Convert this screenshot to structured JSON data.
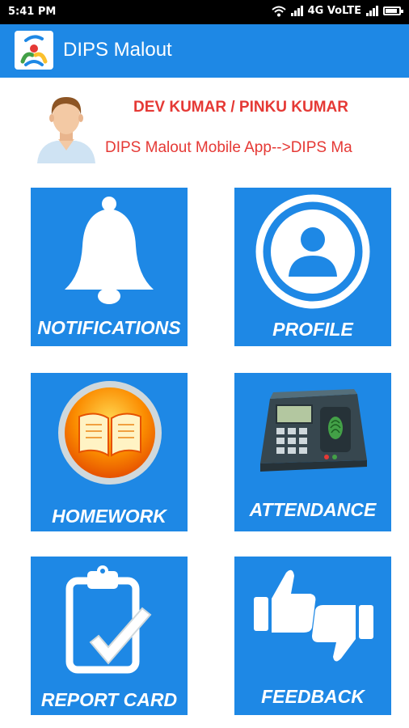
{
  "status_bar": {
    "time": "5:41 PM",
    "network": "4G VoLTE"
  },
  "app_bar": {
    "title": "DIPS Malout"
  },
  "user": {
    "names": "DEV KUMAR / PINKU KUMAR"
  },
  "ticker": {
    "text": "DIPS Malout Mobile App-->DIPS Ma"
  },
  "tiles": [
    {
      "label": "NOTIFICATIONS",
      "icon": "bell-icon"
    },
    {
      "label": "PROFILE",
      "icon": "user-circle-icon"
    },
    {
      "label": "HOMEWORK",
      "icon": "book-icon"
    },
    {
      "label": "ATTENDANCE",
      "icon": "biometric-machine-icon"
    },
    {
      "label": "REPORT CARD",
      "icon": "clipboard-check-icon"
    },
    {
      "label": "FEEDBACK",
      "icon": "thumbs-up-down-icon"
    }
  ],
  "colors": {
    "app_bar": "#1e88e5",
    "tile": "#1e88e5",
    "name_text": "#e53935"
  }
}
